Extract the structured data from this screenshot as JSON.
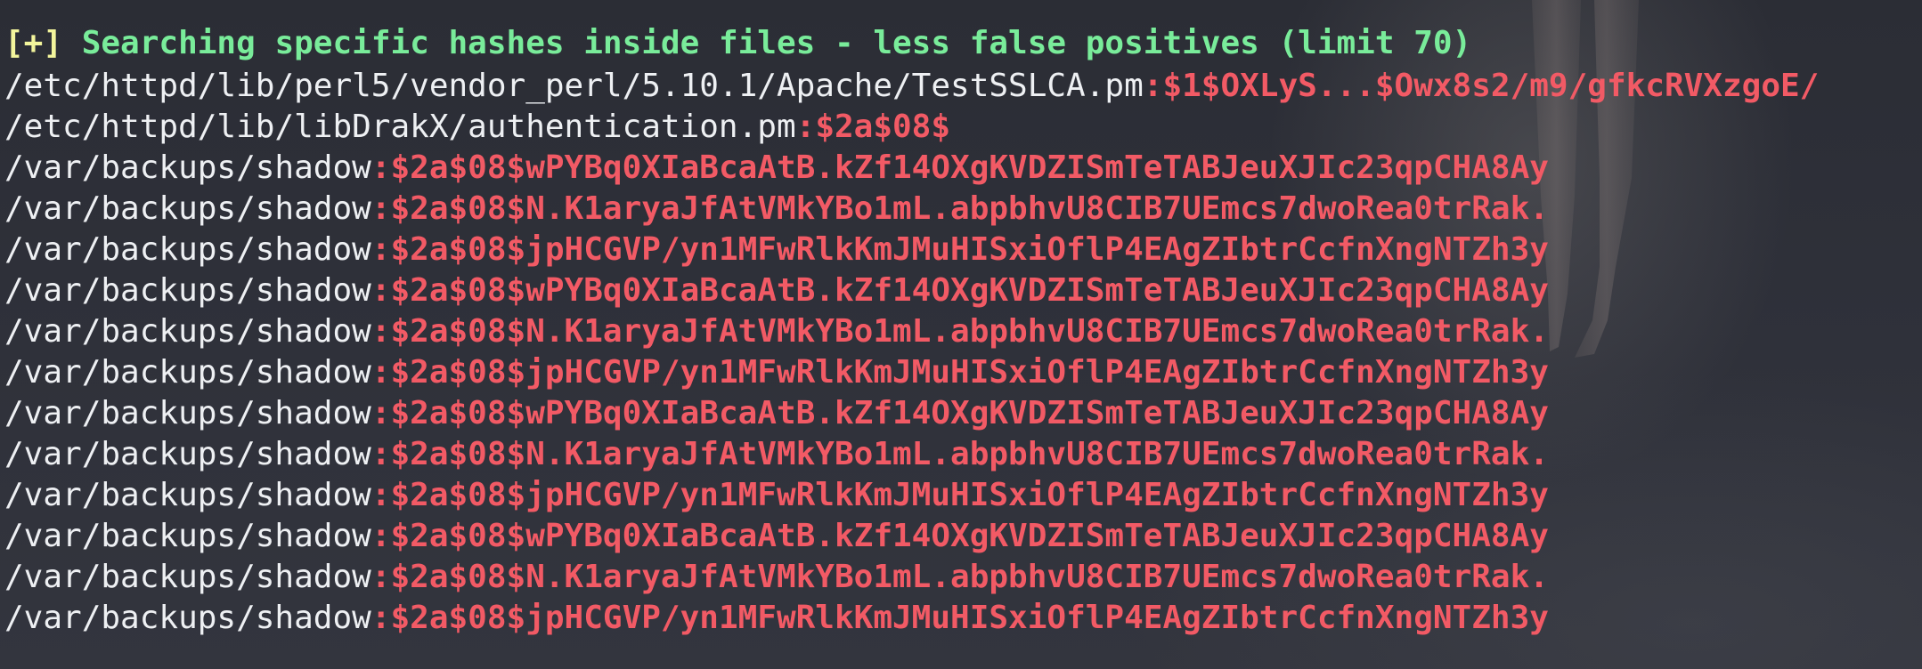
{
  "terminal": {
    "header": {
      "marker": "[+]",
      "text": " Searching specific hashes inside files - less false positives (limit 70)"
    },
    "lines": [
      {
        "path": "/etc/httpd/lib/perl5/vendor_perl/5.10.1/Apache/TestSSLCA.pm",
        "hash": ":$1$OXLyS...$Owx8s2/m9/gfkcRVXzgoE/"
      },
      {
        "path": "/etc/httpd/lib/libDrakX/authentication.pm",
        "hash": ":$2a$08$"
      },
      {
        "path": "/var/backups/shadow",
        "hash": ":$2a$08$wPYBq0XIaBcaAtB.kZf14OXgKVDZISmTeTABJeuXJIc23qpCHA8Ay"
      },
      {
        "path": "/var/backups/shadow",
        "hash": ":$2a$08$N.K1aryaJfAtVMkYBo1mL.abpbhvU8CIB7UEmcs7dwoRea0trRak."
      },
      {
        "path": "/var/backups/shadow",
        "hash": ":$2a$08$jpHCGVP/yn1MFwRlkKmJMuHISxiOflP4EAgZIbtrCcfnXngNTZh3y"
      },
      {
        "path": "/var/backups/shadow",
        "hash": ":$2a$08$wPYBq0XIaBcaAtB.kZf14OXgKVDZISmTeTABJeuXJIc23qpCHA8Ay"
      },
      {
        "path": "/var/backups/shadow",
        "hash": ":$2a$08$N.K1aryaJfAtVMkYBo1mL.abpbhvU8CIB7UEmcs7dwoRea0trRak."
      },
      {
        "path": "/var/backups/shadow",
        "hash": ":$2a$08$jpHCGVP/yn1MFwRlkKmJMuHISxiOflP4EAgZIbtrCcfnXngNTZh3y"
      },
      {
        "path": "/var/backups/shadow",
        "hash": ":$2a$08$wPYBq0XIaBcaAtB.kZf14OXgKVDZISmTeTABJeuXJIc23qpCHA8Ay"
      },
      {
        "path": "/var/backups/shadow",
        "hash": ":$2a$08$N.K1aryaJfAtVMkYBo1mL.abpbhvU8CIB7UEmcs7dwoRea0trRak."
      },
      {
        "path": "/var/backups/shadow",
        "hash": ":$2a$08$jpHCGVP/yn1MFwRlkKmJMuHISxiOflP4EAgZIbtrCcfnXngNTZh3y"
      },
      {
        "path": "/var/backups/shadow",
        "hash": ":$2a$08$wPYBq0XIaBcaAtB.kZf14OXgKVDZISmTeTABJeuXJIc23qpCHA8Ay"
      },
      {
        "path": "/var/backups/shadow",
        "hash": ":$2a$08$N.K1aryaJfAtVMkYBo1mL.abpbhvU8CIB7UEmcs7dwoRea0trRak."
      },
      {
        "path": "/var/backups/shadow",
        "hash": ":$2a$08$jpHCGVP/yn1MFwRlkKmJMuHISxiOflP4EAgZIbtrCcfnXngNTZh3y"
      }
    ]
  },
  "colors": {
    "background": "#2e3039",
    "marker": "#f3f59c",
    "header_text": "#79ec9a",
    "path_text": "#eef0f3",
    "hash_text": "#f25a65"
  }
}
